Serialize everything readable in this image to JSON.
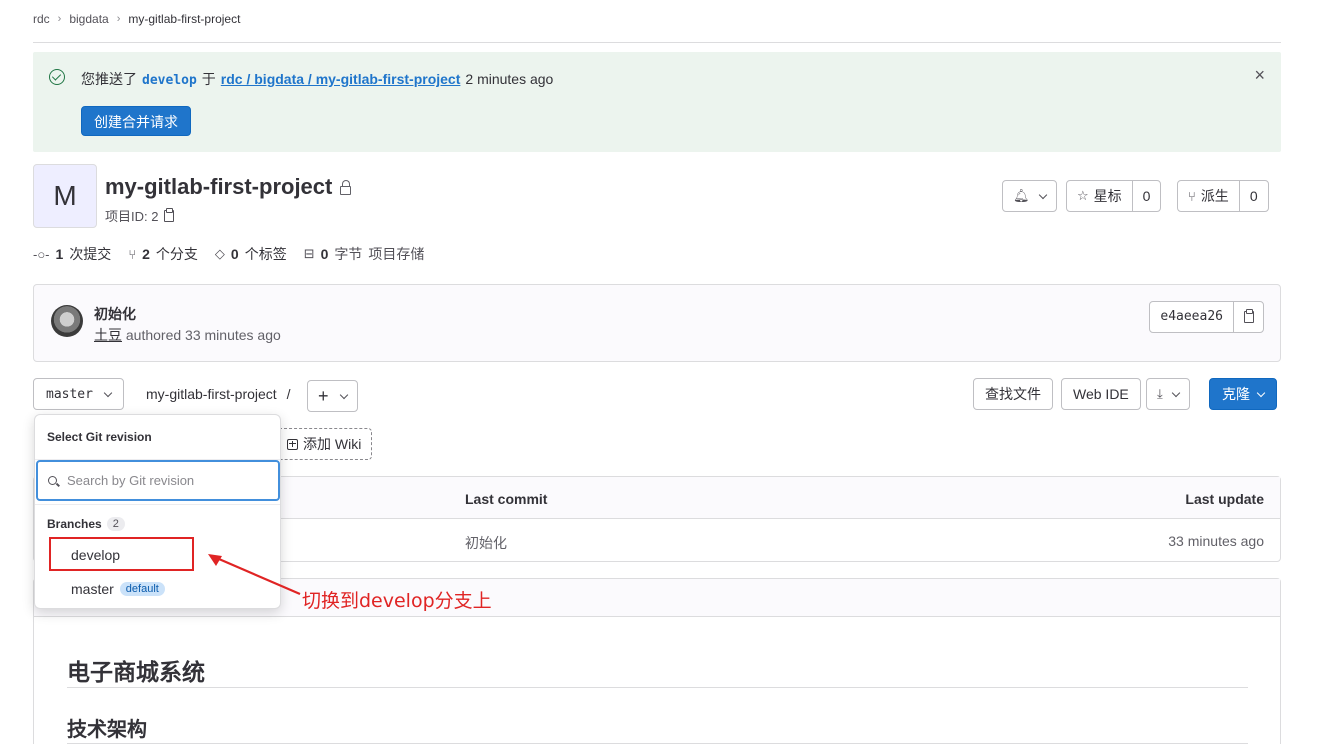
{
  "breadcrumbs": [
    "rdc",
    "bigdata",
    "my-gitlab-first-project"
  ],
  "alert": {
    "prefix": "您推送了",
    "branch": "develop",
    "mid": "于",
    "link": "rdc / bigdata / my-gitlab-first-project",
    "time": "2 minutes ago",
    "button": "创建合并请求",
    "close": "×"
  },
  "project": {
    "avatar_letter": "M",
    "name": "my-gitlab-first-project",
    "id_label": "项目ID: 2"
  },
  "actions": {
    "star_label": "星标",
    "star_count": "0",
    "fork_label": "派生",
    "fork_count": "0"
  },
  "stats": {
    "commits_num": "1",
    "commits_label": "次提交",
    "branches_num": "2",
    "branches_label": "个分支",
    "tags_num": "0",
    "tags_label": "个标签",
    "storage_num": "0",
    "storage_unit": "字节",
    "storage_label": "项目存储"
  },
  "commit": {
    "title": "初始化",
    "author": "土豆",
    "meta": "authored 33 minutes ago",
    "sha": "e4aeea26"
  },
  "toolbar": {
    "branch": "master",
    "path": "my-gitlab-first-project",
    "path_sep": "/",
    "find_file": "查找文件",
    "web_ide": "Web IDE",
    "clone": "克隆"
  },
  "wiki_button": "添加 Wiki",
  "table": {
    "col_last_commit": "Last commit",
    "col_last_update": "Last update",
    "row_commit": "初始化",
    "row_update": "33 minutes ago"
  },
  "readme": {
    "h1": "电子商城系统",
    "h2": "技术架构"
  },
  "dropdown": {
    "title": "Select Git revision",
    "search_placeholder": "Search by Git revision",
    "group_label": "Branches",
    "group_count": "2",
    "options": [
      "develop",
      "master"
    ],
    "default_badge": "default"
  },
  "annotation": {
    "text": "切换到develop分支上",
    "color": "#e02424"
  },
  "colors": {
    "primary": "#1f75cb",
    "alert_bg": "#ecf4ee"
  }
}
